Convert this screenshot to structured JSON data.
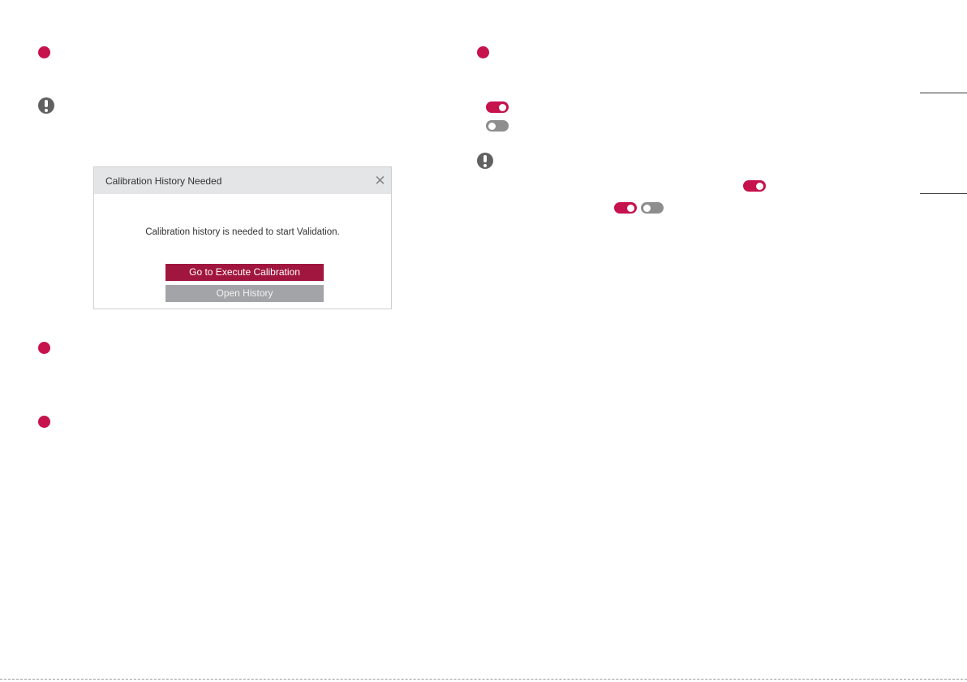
{
  "dialog": {
    "title": "Calibration History Needed",
    "close_glyph": "✕",
    "message": "Calibration history is needed to start Validation.",
    "primary_button": "Go to Execute Calibration",
    "secondary_button": "Open History"
  },
  "icons": {
    "bullet": "red-dot-bullet-icon",
    "note": "exclamation-note-icon",
    "toggle_on": "toggle-on-icon",
    "toggle_off": "toggle-off-icon",
    "close": "close-icon"
  },
  "toggles": {
    "legend_on": true,
    "legend_off": false,
    "note_inline": true,
    "note_pair_first": true,
    "note_pair_second": false
  },
  "colors": {
    "accent": "#c6124d",
    "primary_button": "#a0163e",
    "secondary_button": "#a3a4a7",
    "toggle_off": "#8e8e8e",
    "note_icon": "#616161",
    "titlebar": "#e4e5e7"
  }
}
